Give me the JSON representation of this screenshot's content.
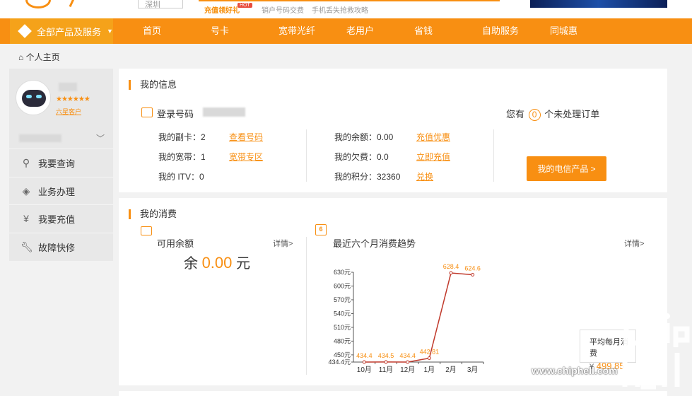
{
  "header": {
    "city": "深圳",
    "promo": "充值领好礼",
    "promo_badge": "HOT",
    "links": [
      "销户号码交费",
      "手机丢失抢救攻略"
    ]
  },
  "nav": {
    "all_label": "全部产品及服务",
    "items": [
      "首页",
      "号卡",
      "宽带光纤",
      "老用户",
      "省钱",
      "自助服务",
      "同城惠"
    ]
  },
  "breadcrumb": "个人主页",
  "sidebar": {
    "stars": "★★★★★★",
    "level": "六星客户",
    "menu": [
      {
        "label": "我要查询",
        "icon": "search-icon"
      },
      {
        "label": "业务办理",
        "icon": "layers-icon"
      },
      {
        "label": "我要充值",
        "icon": "yuan-icon"
      },
      {
        "label": "故障快修",
        "icon": "wrench-icon"
      }
    ]
  },
  "info": {
    "title": "我的信息",
    "login_label": "登录号码",
    "vice_card": "我的副卡：2",
    "vice_link": "查看号码",
    "broadband": "我的宽带：1",
    "broadband_link": "宽带专区",
    "itv": "我的 ITV：0",
    "balance": "我的余额：0.00",
    "balance_link": "充值优惠",
    "arrears": "我的欠费：0.0",
    "arrears_link": "立即充值",
    "points": "我的积分：32360",
    "points_link": "兑换",
    "orders_prefix": "您有",
    "orders_count": "0",
    "orders_suffix": "个未处理订单",
    "products_button": "我的电信产品 >"
  },
  "consumption": {
    "title": "我的消费",
    "available_label": "可用余额",
    "details": "详情>",
    "balance_prefix": "余",
    "balance_amount": "0.00",
    "balance_unit": "元",
    "trend_label": "最近六个月消费趋势",
    "trend_details": "详情>",
    "calendar_digit": "6",
    "avg_label": "平均每月消费",
    "avg_currency": "¥",
    "avg_value": "499.85"
  },
  "chart_data": {
    "type": "line",
    "categories": [
      "10月",
      "11月",
      "12月",
      "1月",
      "2月",
      "3月"
    ],
    "values": [
      434.4,
      434.5,
      434.4,
      442.81,
      628.4,
      624.6
    ],
    "value_labels": [
      "434.4",
      "434.5",
      "434.4",
      "442.81",
      "628.4",
      "624.6"
    ],
    "y_ticks": [
      "434.4元",
      "450元",
      "480元",
      "510元",
      "540元",
      "570元",
      "600元",
      "630元"
    ],
    "y_tick_values": [
      434.4,
      450,
      480,
      510,
      540,
      570,
      600,
      630
    ],
    "ylim": [
      434.4,
      630
    ],
    "line_color": "#c0392b",
    "label_color": "#f88f12"
  },
  "watermark": {
    "url": "www.chiphell.com"
  },
  "colors": {
    "accent": "#f88f12"
  }
}
